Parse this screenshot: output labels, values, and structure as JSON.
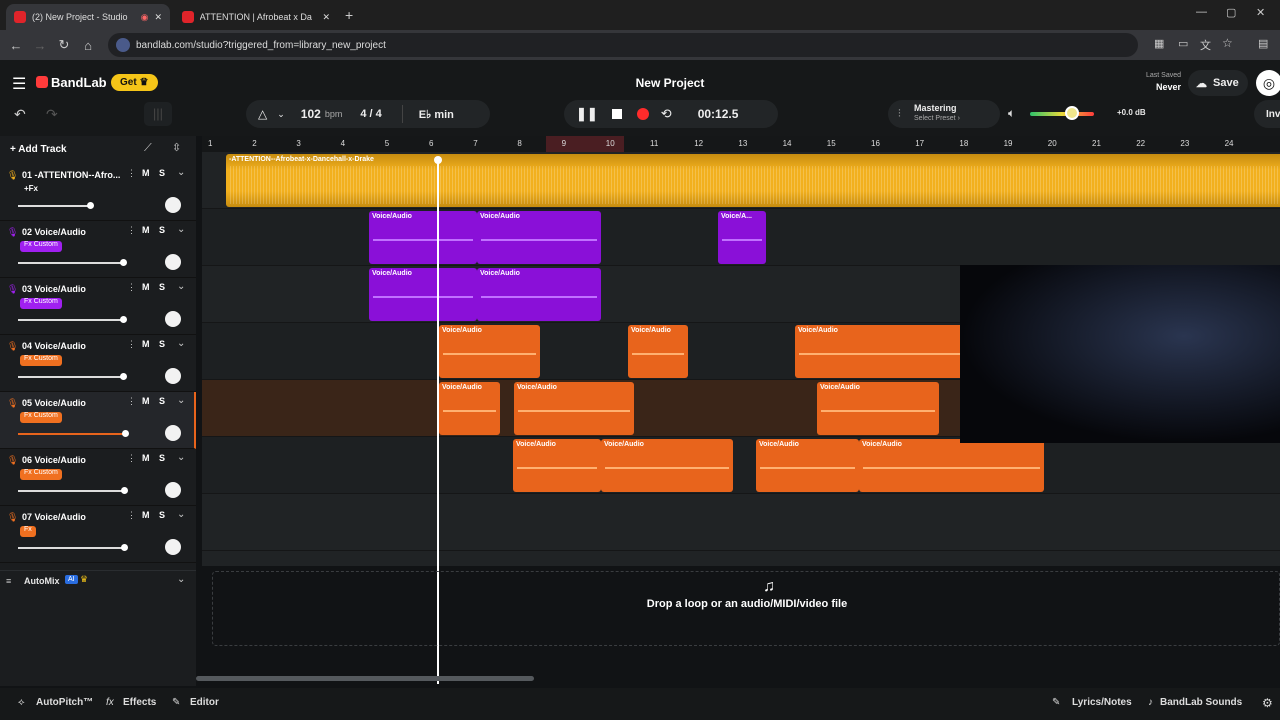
{
  "browser": {
    "tabs": [
      {
        "label": "(2) New Project - Studio"
      },
      {
        "label": "ATTENTION | Afrobeat x Da"
      }
    ],
    "url": "bandlab.com/studio?triggered_from=library_new_project"
  },
  "header": {
    "brand": "BandLab",
    "get_label": "Get",
    "project_title": "New Project",
    "last_saved_label": "Last Saved",
    "last_saved_value": "Never",
    "save_label": "Save",
    "bpm": "102",
    "bpm_unit": "bpm",
    "time_sig": "4 / 4",
    "key": "E♭ min",
    "time": "00:12.5",
    "mastering_label": "Mastering",
    "mastering_sub": "Select Preset ›",
    "volume_db": "+0.0 dB",
    "invite": "Inv"
  },
  "tracks": [
    {
      "name": "01 -ATTENTION--Afro...",
      "fx": "+Fx",
      "color": "#f2b01e"
    },
    {
      "name": "02 Voice/Audio",
      "fx": "Fx Custom",
      "color": "#a020f0"
    },
    {
      "name": "03 Voice/Audio",
      "fx": "Fx Custom",
      "color": "#a020f0"
    },
    {
      "name": "04 Voice/Audio",
      "fx": "Fx Custom",
      "color": "#f07020"
    },
    {
      "name": "05 Voice/Audio",
      "fx": "Fx Custom",
      "color": "#f07020"
    },
    {
      "name": "06 Voice/Audio",
      "fx": "Fx Custom",
      "color": "#f07020"
    },
    {
      "name": "07 Voice/Audio",
      "fx": "Fx",
      "color": "#f07020"
    }
  ],
  "add_track": "Add Track",
  "automix": "AutoMix",
  "automix_ai": "AI",
  "ms": {
    "m": "M",
    "s": "S"
  },
  "ruler": [
    "1",
    "2",
    "3",
    "4",
    "5",
    "6",
    "7",
    "8",
    "9",
    "10",
    "11",
    "12",
    "13",
    "14",
    "15",
    "16",
    "17",
    "18",
    "19",
    "20",
    "21",
    "22",
    "23",
    "24"
  ],
  "clips": {
    "track1": "-ATTENTION--Afrobeat-x-Dancehall-x-Drake",
    "voice": "Voice/Audio",
    "voice_short": "Voice/A..."
  },
  "dropzone": "Drop a loop or an audio/MIDI/video file",
  "bottom": {
    "autopitch": "AutoPitch™",
    "effects": "Effects",
    "editor": "Editor",
    "lyrics": "Lyrics/Notes",
    "sounds": "BandLab Sounds"
  },
  "colors": {
    "gold": "#f2b01e",
    "purple": "#8a10d8",
    "orange": "#e8641c",
    "accent": "#ff3b3b"
  }
}
